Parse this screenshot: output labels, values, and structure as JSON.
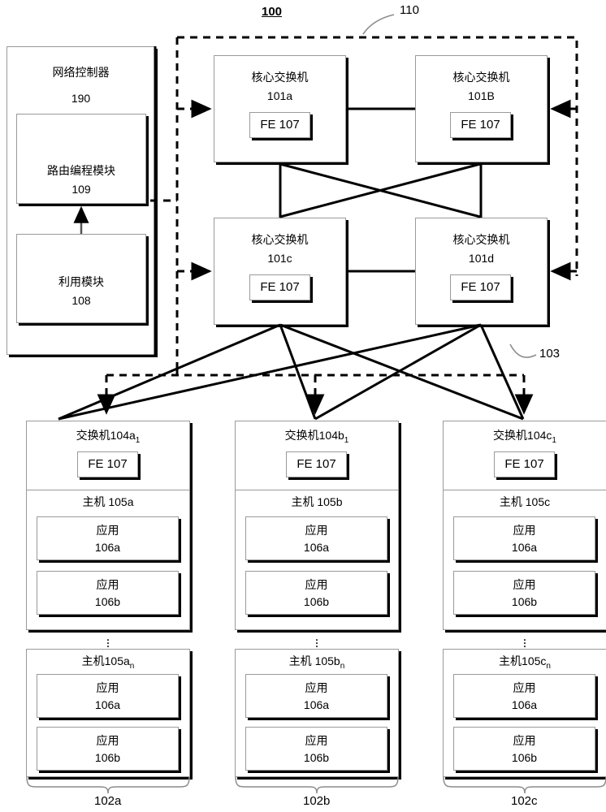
{
  "figure": {
    "id_label": "100",
    "core_group_label": "110",
    "access_group_label": "103"
  },
  "controller": {
    "title": "网络控制器",
    "ref": "190",
    "modules": [
      {
        "name": "routing-programming-module",
        "title": "路由编程模块",
        "ref": "109"
      },
      {
        "name": "utilization-module",
        "title": "利用模块",
        "ref": "108"
      }
    ]
  },
  "core_switches": [
    {
      "title": "核心交换机",
      "ref": "101a",
      "fe": "FE 107"
    },
    {
      "title": "核心交换机",
      "ref": "101B",
      "fe": "FE 107"
    },
    {
      "title": "核心交换机",
      "ref": "101c",
      "fe": "FE 107"
    },
    {
      "title": "核心交换机",
      "ref": "101d",
      "fe": "FE 107"
    }
  ],
  "racks": [
    {
      "group_ref": "102a",
      "switch": {
        "title": "交换机",
        "ref": "104a",
        "ref_sub": "1",
        "fe": "FE 107"
      },
      "hosts": [
        {
          "title": "主机",
          "ref": "105a",
          "ref_sub": "",
          "apps": [
            {
              "title": "应用",
              "ref": "106a"
            },
            {
              "title": "应用",
              "ref": "106b"
            }
          ]
        },
        {
          "title": "主机",
          "ref": "105a",
          "ref_sub": "n",
          "apps": [
            {
              "title": "应用",
              "ref": "106a"
            },
            {
              "title": "应用",
              "ref": "106b"
            }
          ]
        }
      ]
    },
    {
      "group_ref": "102b",
      "switch": {
        "title": "交换机",
        "ref": "104b",
        "ref_sub": "1",
        "fe": "FE 107"
      },
      "hosts": [
        {
          "title": "主机",
          "ref": "105b",
          "ref_sub": "",
          "apps": [
            {
              "title": "应用",
              "ref": "106a"
            },
            {
              "title": "应用",
              "ref": "106b"
            }
          ]
        },
        {
          "title": "主机",
          "ref": "105b",
          "ref_sub": "n",
          "apps": [
            {
              "title": "应用",
              "ref": "106a"
            },
            {
              "title": "应用",
              "ref": "106b"
            }
          ]
        }
      ]
    },
    {
      "group_ref": "102c",
      "switch": {
        "title": "交换机",
        "ref": "104c",
        "ref_sub": "1",
        "fe": "FE 107"
      },
      "hosts": [
        {
          "title": "主机",
          "ref": "105c",
          "ref_sub": "",
          "apps": [
            {
              "title": "应用",
              "ref": "106a"
            },
            {
              "title": "应用",
              "ref": "106b"
            }
          ]
        },
        {
          "title": "主机",
          "ref": "105c",
          "ref_sub": "n",
          "apps": [
            {
              "title": "应用",
              "ref": "106a"
            },
            {
              "title": "应用",
              "ref": "106b"
            }
          ]
        }
      ]
    }
  ],
  "colors": {
    "stroke": "#000000",
    "box_border": "#9a9a9a",
    "leader": "#8c8c8c",
    "background": "#ffffff"
  }
}
